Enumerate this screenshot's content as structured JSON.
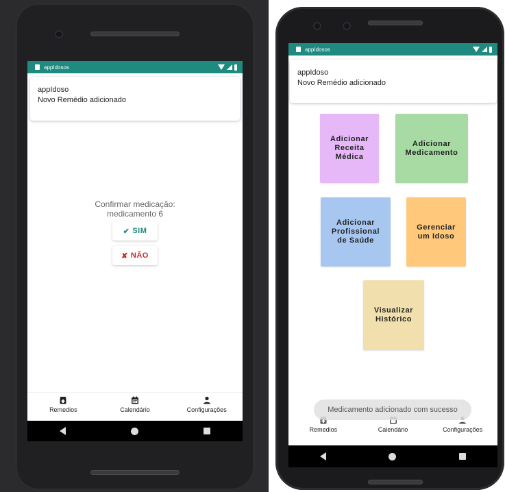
{
  "left_phone": {
    "status": {
      "app_name": "appIdosos"
    },
    "notification": {
      "title": "appIdoso",
      "body": "Novo Remédio adicionado"
    },
    "confirm": {
      "line1": "Confirmar medicação:",
      "line2": "medicamento 6",
      "yes_mark": "✔",
      "yes_label": "SIM",
      "no_mark": "✘",
      "no_label": "NÃO"
    },
    "nav": [
      {
        "label": "Remedios",
        "icon": "medicine-icon"
      },
      {
        "label": "Calendário",
        "icon": "calendar-icon"
      },
      {
        "label": "Configurações",
        "icon": "person-icon"
      }
    ]
  },
  "right_phone": {
    "status": {
      "app_name": "appIdosos"
    },
    "notification": {
      "title": "appIdoso",
      "body": "Novo Remédio adicionado"
    },
    "tiles": {
      "receita": {
        "label": "Adicionar\nReceita\nMédica",
        "color": "#e6b8f7"
      },
      "medicamento": {
        "label": "Adicionar\nMedicamento",
        "color": "#a7dba3"
      },
      "profissional": {
        "label": "Adicionar\nProfissional\nde Saúde",
        "color": "#a8c7f0"
      },
      "idoso": {
        "label": "Gerenciar\num Idoso",
        "color": "#ffc87a"
      },
      "historico": {
        "label": "Visualizar\nHistórico",
        "color": "#f1dfae"
      }
    },
    "toast": "Medicamento adicionado com sucesso",
    "nav": [
      {
        "label": "Remedios",
        "icon": "medicine-icon"
      },
      {
        "label": "Calendário",
        "icon": "calendar-icon"
      },
      {
        "label": "Configurações",
        "icon": "person-icon"
      }
    ]
  },
  "colors": {
    "accent": "#1e8a80",
    "danger": "#c62828"
  }
}
